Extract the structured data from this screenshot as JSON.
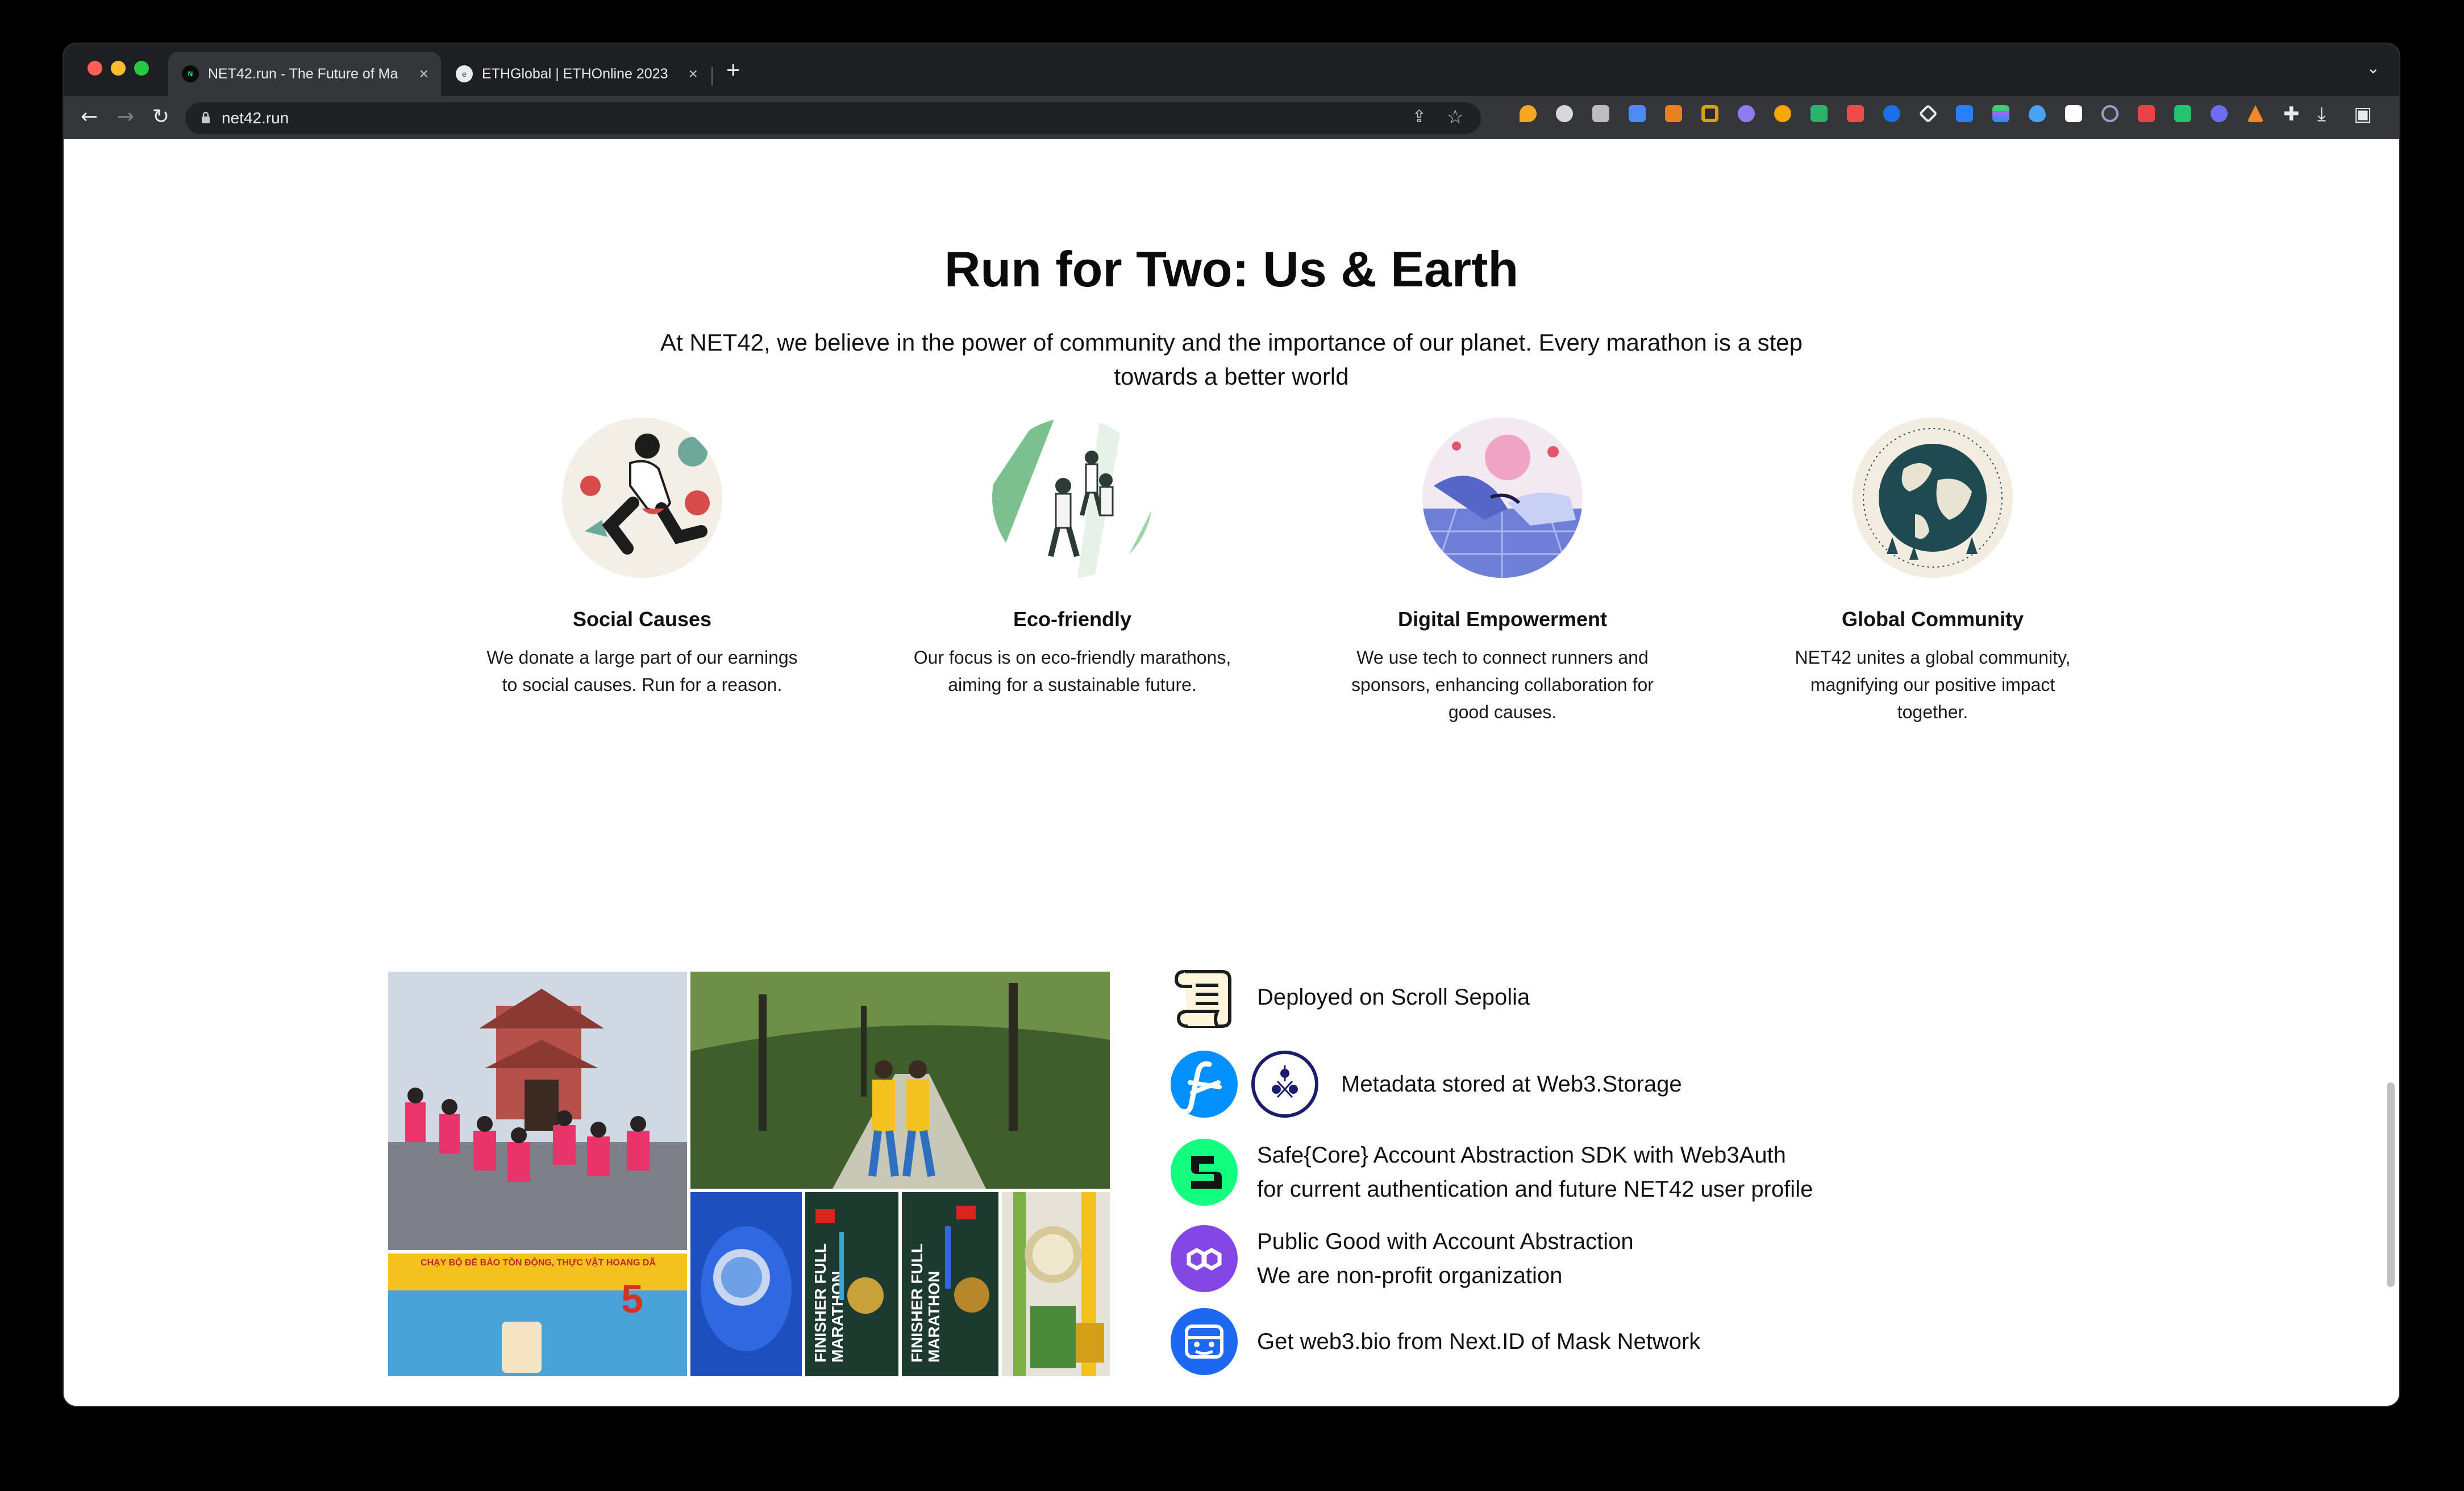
{
  "browser": {
    "tabs": [
      {
        "title": "NET42.run - The Future of Ma",
        "favicon": "net42-favicon",
        "active": true
      },
      {
        "title": "ETHGlobal | ETHOnline 2023",
        "favicon": "ethglobal-favicon",
        "active": false
      }
    ],
    "url": "net42.run",
    "extensions_count": 22
  },
  "page": {
    "heading": "Run for Two: Us & Earth",
    "intro": "At NET42, we believe in the power of community and the importance of our planet. Every marathon is a step towards a better world",
    "features": [
      {
        "title": "Social Causes",
        "description": "We donate a large part of our earnings to social causes. Run for a reason.",
        "image": "runner-social-illustration"
      },
      {
        "title": "Eco-friendly",
        "description": "Our focus is on eco-friendly marathons, aiming for a sustainable future.",
        "image": "runners-forest-illustration"
      },
      {
        "title": "Digital Empowerment",
        "description": "We use tech to connect runners and sponsors, enhancing collaboration for good causes.",
        "image": "digital-handshake-illustration"
      },
      {
        "title": "Global Community",
        "description": "NET42 unites a global community, magnifying our positive impact together.",
        "image": "globe-illustration"
      }
    ],
    "tech": [
      {
        "lines": [
          "Deployed on Scroll Sepolia"
        ],
        "icons": [
          "scroll-icon"
        ]
      },
      {
        "lines": [
          "Metadata stored at Web3.Storage"
        ],
        "icons": [
          "filecoin-icon",
          "web3storage-icon"
        ]
      },
      {
        "lines": [
          "Safe{Core} Account Abstraction SDK with Web3Auth",
          "for current authentication and future NET42 user profile"
        ],
        "icons": [
          "safe-icon"
        ]
      },
      {
        "lines": [
          "Public Good with Account Abstraction",
          "We are non-profit organization"
        ],
        "icons": [
          "polygon-icon"
        ]
      },
      {
        "lines": [
          "Get web3.bio from Next.ID of Mask Network"
        ],
        "icons": [
          "mask-network-icon"
        ]
      }
    ],
    "collage_signs": {
      "banner": "CHẠY BỘ ĐỂ BẢO TỒN ĐỘNG, THỰC VẬT HOANG DÃ",
      "bib_left": "FINISHER FULL MARATHON",
      "bib_right": "FINISHER FULL MARATHON"
    }
  },
  "colors": {
    "accent_green": "#12ff80",
    "filecoin_blue": "#0090ff",
    "polygon_purple": "#8247e5",
    "mask_blue": "#1c68f3"
  }
}
